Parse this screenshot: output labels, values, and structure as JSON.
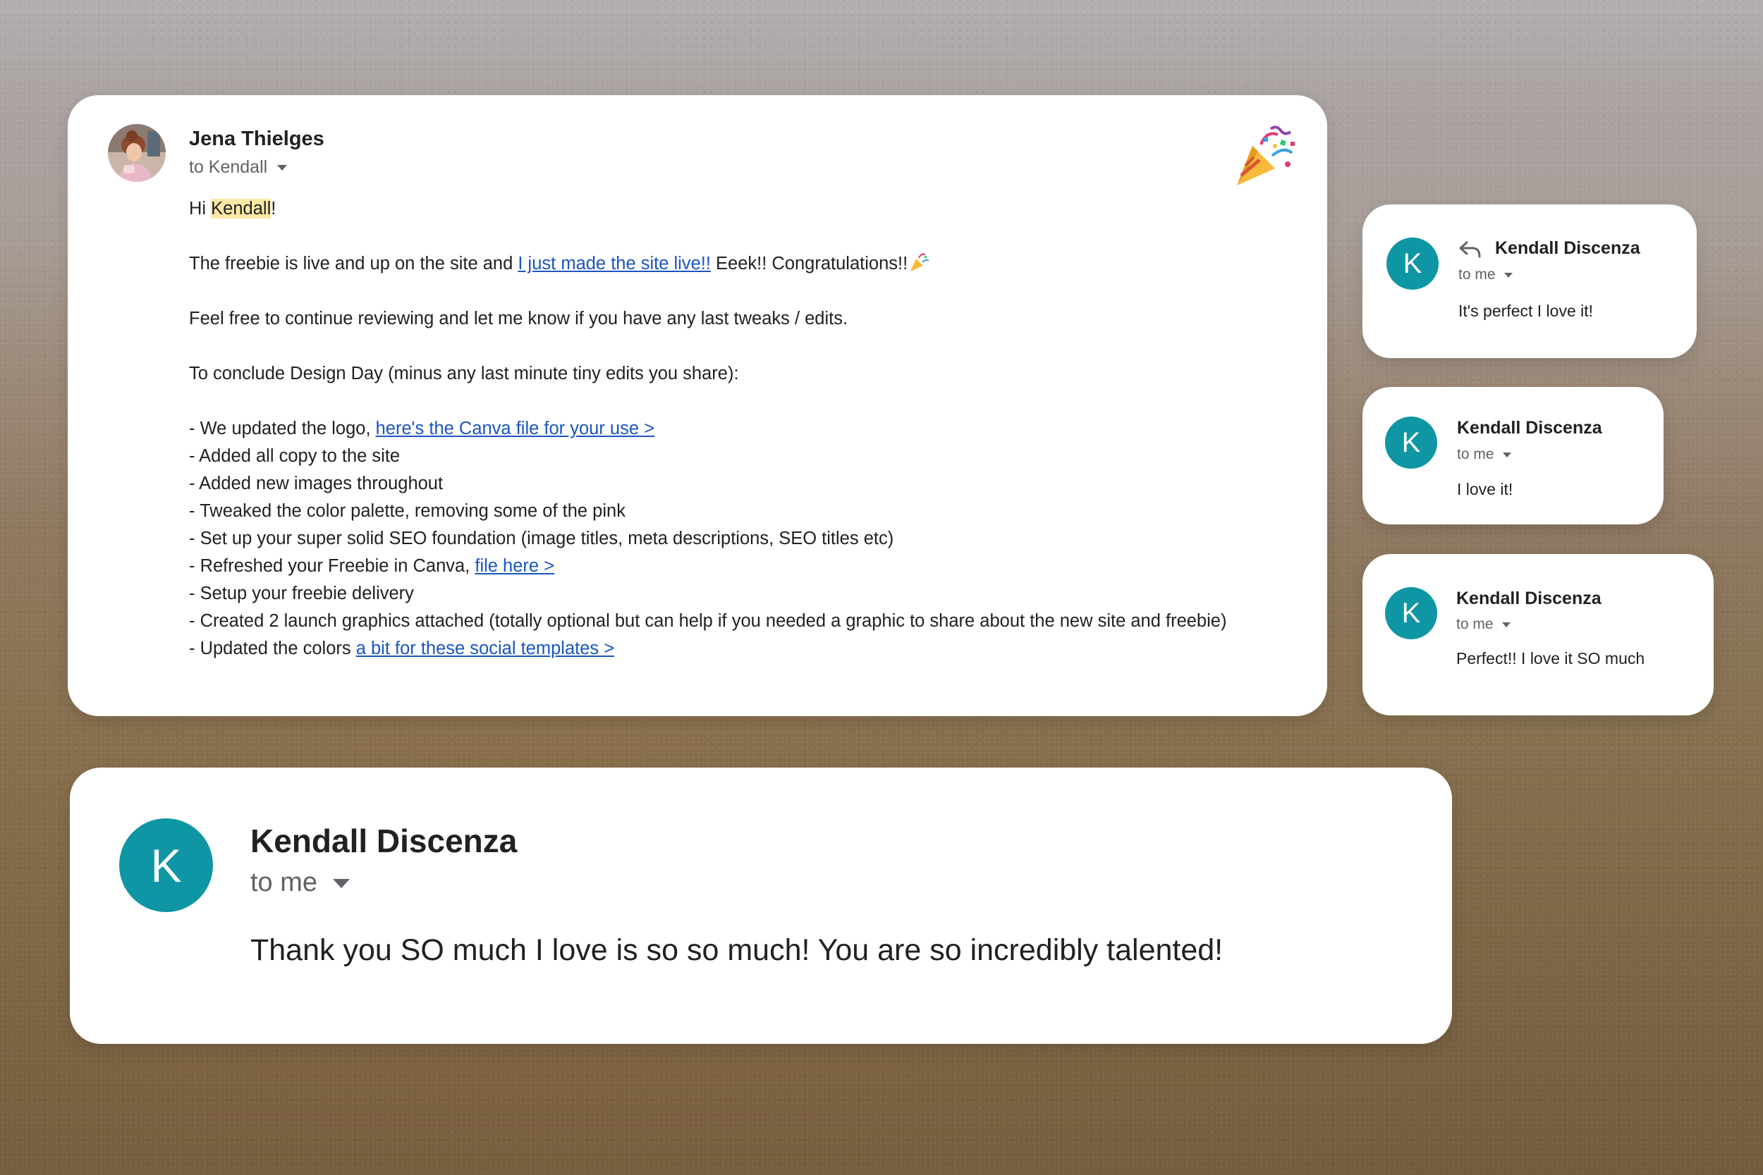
{
  "main_email": {
    "sender": "Jena Thielges",
    "to_label": "to Kendall",
    "greeting_prefix": "Hi ",
    "greeting_name": "Kendall",
    "greeting_suffix": "!",
    "line1_before": "The freebie is live and up on the site and ",
    "line1_link": "I just made the site live!!",
    "line1_after": " Eeek!! Congratulations!!",
    "line2": "Feel free to continue reviewing and let me know if you have any last tweaks / edits.",
    "line3": "To conclude Design Day (minus any last minute tiny edits you share):",
    "list": [
      {
        "text": "- We updated the logo, ",
        "link": "here's the Canva file for your use >"
      },
      {
        "text": "- Added all copy to the site",
        "link": ""
      },
      {
        "text": "- Added new images throughout",
        "link": ""
      },
      {
        "text": "- Tweaked the color palette, removing some of the pink",
        "link": ""
      },
      {
        "text": "- Set up your super solid SEO foundation (image titles, meta descriptions, SEO titles etc)",
        "link": ""
      },
      {
        "text": "- Refreshed your Freebie in Canva, ",
        "link": "file here >"
      },
      {
        "text": "- Setup your freebie delivery",
        "link": ""
      },
      {
        "text": "- Created 2 launch graphics attached (totally optional but can help if you needed a graphic to share about the new site and freebie)",
        "link": ""
      },
      {
        "text": "- Updated the colors ",
        "link": "a bit for these social templates >"
      }
    ]
  },
  "replies": [
    {
      "initial": "K",
      "name": "Kendall Discenza",
      "to_label": "to me",
      "message": "It's perfect I love it!"
    },
    {
      "initial": "K",
      "name": "Kendall Discenza",
      "to_label": "to me",
      "message": "I love it!"
    },
    {
      "initial": "K",
      "name": "Kendall Discenza",
      "to_label": "to me",
      "message": "Perfect!! I love it SO much"
    }
  ],
  "big_reply": {
    "initial": "K",
    "name": "Kendall Discenza",
    "to_label": "to me",
    "message": "Thank you SO much I love is so so much! You are so incredibly talented!"
  },
  "colors": {
    "avatar_teal": "#0f96a4",
    "link_blue": "#1a55c2",
    "highlight_yellow": "#fce8a6"
  },
  "icons": [
    "party-popper-icon",
    "reply-arrow-icon",
    "chevron-down-icon"
  ]
}
